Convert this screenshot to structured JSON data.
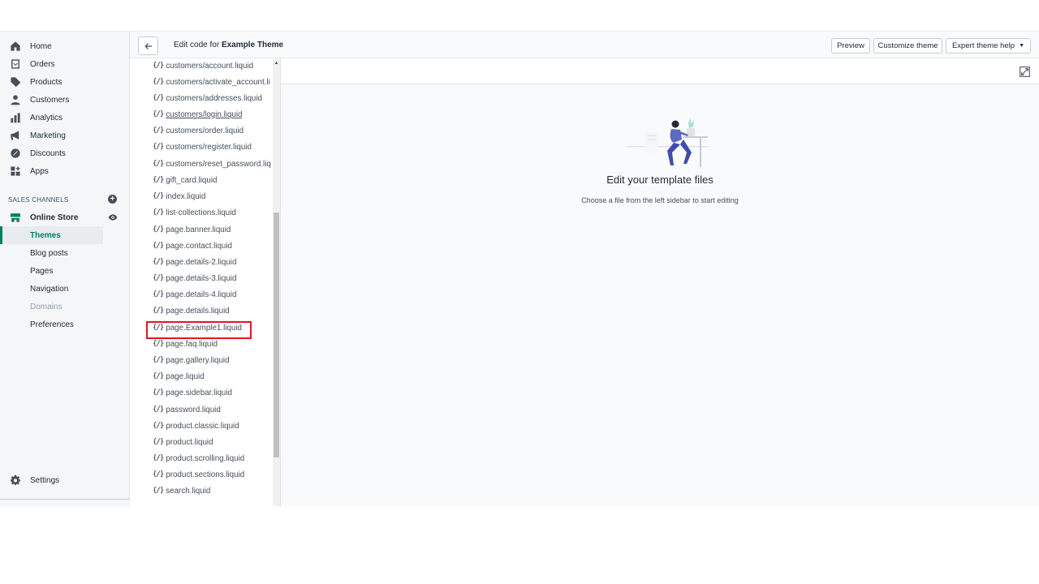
{
  "nav": {
    "main": [
      {
        "label": "Home",
        "icon": "home-icon"
      },
      {
        "label": "Orders",
        "icon": "orders-icon"
      },
      {
        "label": "Products",
        "icon": "tag-icon"
      },
      {
        "label": "Customers",
        "icon": "person-icon"
      },
      {
        "label": "Analytics",
        "icon": "bar-chart-icon"
      },
      {
        "label": "Marketing",
        "icon": "megaphone-icon"
      },
      {
        "label": "Discounts",
        "icon": "discount-icon"
      },
      {
        "label": "Apps",
        "icon": "apps-icon"
      }
    ],
    "sales_channels_title": "SALES CHANNELS",
    "online_store": "Online Store",
    "online_store_sub": [
      {
        "label": "Themes",
        "state": "active"
      },
      {
        "label": "Blog posts",
        "state": "normal"
      },
      {
        "label": "Pages",
        "state": "normal"
      },
      {
        "label": "Navigation",
        "state": "normal"
      },
      {
        "label": "Domains",
        "state": "disabled"
      },
      {
        "label": "Preferences",
        "state": "normal"
      }
    ],
    "settings": "Settings"
  },
  "topbar": {
    "title_prefix": "Edit code for",
    "theme_name": "Example Theme",
    "preview": "Preview",
    "customize": "Customize theme",
    "expert_help": "Expert theme help"
  },
  "files": [
    "customers/account.liquid",
    "customers/activate_account.li",
    "customers/addresses.liquid",
    "customers/login.liquid",
    "customers/order.liquid",
    "customers/register.liquid",
    "customers/reset_password.liq",
    "gift_card.liquid",
    "index.liquid",
    "list-collections.liquid",
    "page.banner.liquid",
    "page.contact.liquid",
    "page.details-2.liquid",
    "page.details-3.liquid",
    "page.details-4.liquid",
    "page.details.liquid",
    "page.Example1.liquid",
    "page.faq.liquid",
    "page.gallery.liquid",
    "page.liquid",
    "page.sidebar.liquid",
    "password.liquid",
    "product.classic.liquid",
    "product.liquid",
    "product.scrolling.liquid",
    "product.sections.liquid",
    "search.liquid"
  ],
  "file_icon_glyph": "{/}",
  "editor": {
    "empty_title": "Edit your template files",
    "empty_subtitle": "Choose a file from the left sidebar to start editing"
  },
  "colors": {
    "accent_green": "#008060",
    "highlight_red": "#e1181f",
    "illustration_purple": "#5c6ac4"
  }
}
